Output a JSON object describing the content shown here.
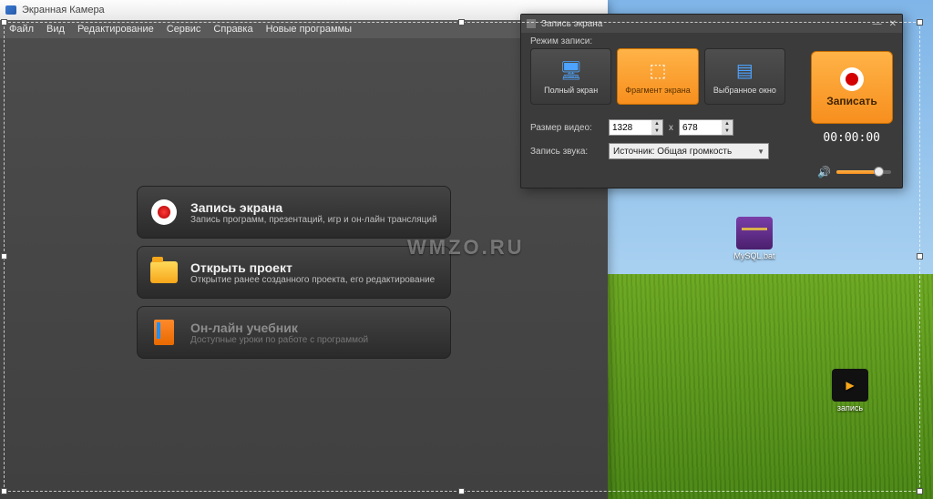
{
  "app": {
    "title": "Экранная Камера"
  },
  "menu": {
    "file": "Файл",
    "view": "Вид",
    "edit": "Редактирование",
    "service": "Сервис",
    "help": "Справка",
    "new": "Новые программы"
  },
  "cards": {
    "record": {
      "title": "Запись экрана",
      "sub": "Запись программ, презентаций, игр и он-лайн трансляций"
    },
    "open": {
      "title": "Открыть проект",
      "sub": "Открытие ранее созданного проекта, его редактирование"
    },
    "tutorial": {
      "title": "Он-лайн учебник",
      "sub": "Доступные уроки по работе с программой"
    }
  },
  "watermark": "WMZO.RU",
  "popup": {
    "title": "Запись экрана",
    "mode_label": "Режим записи:",
    "modes": {
      "full": "Полный экран",
      "fragment": "Фрагмент экрана",
      "window": "Выбранное окно"
    },
    "record_btn": "Записать",
    "timer": "00:00:00",
    "size_label": "Размер видео:",
    "width": "1328",
    "height": "678",
    "sep": "x",
    "sound_label": "Запись звука:",
    "sound_source": "Источник: Общая громкость"
  },
  "desktop_icons": {
    "rar": "MySQL.bat",
    "media": "запись"
  }
}
